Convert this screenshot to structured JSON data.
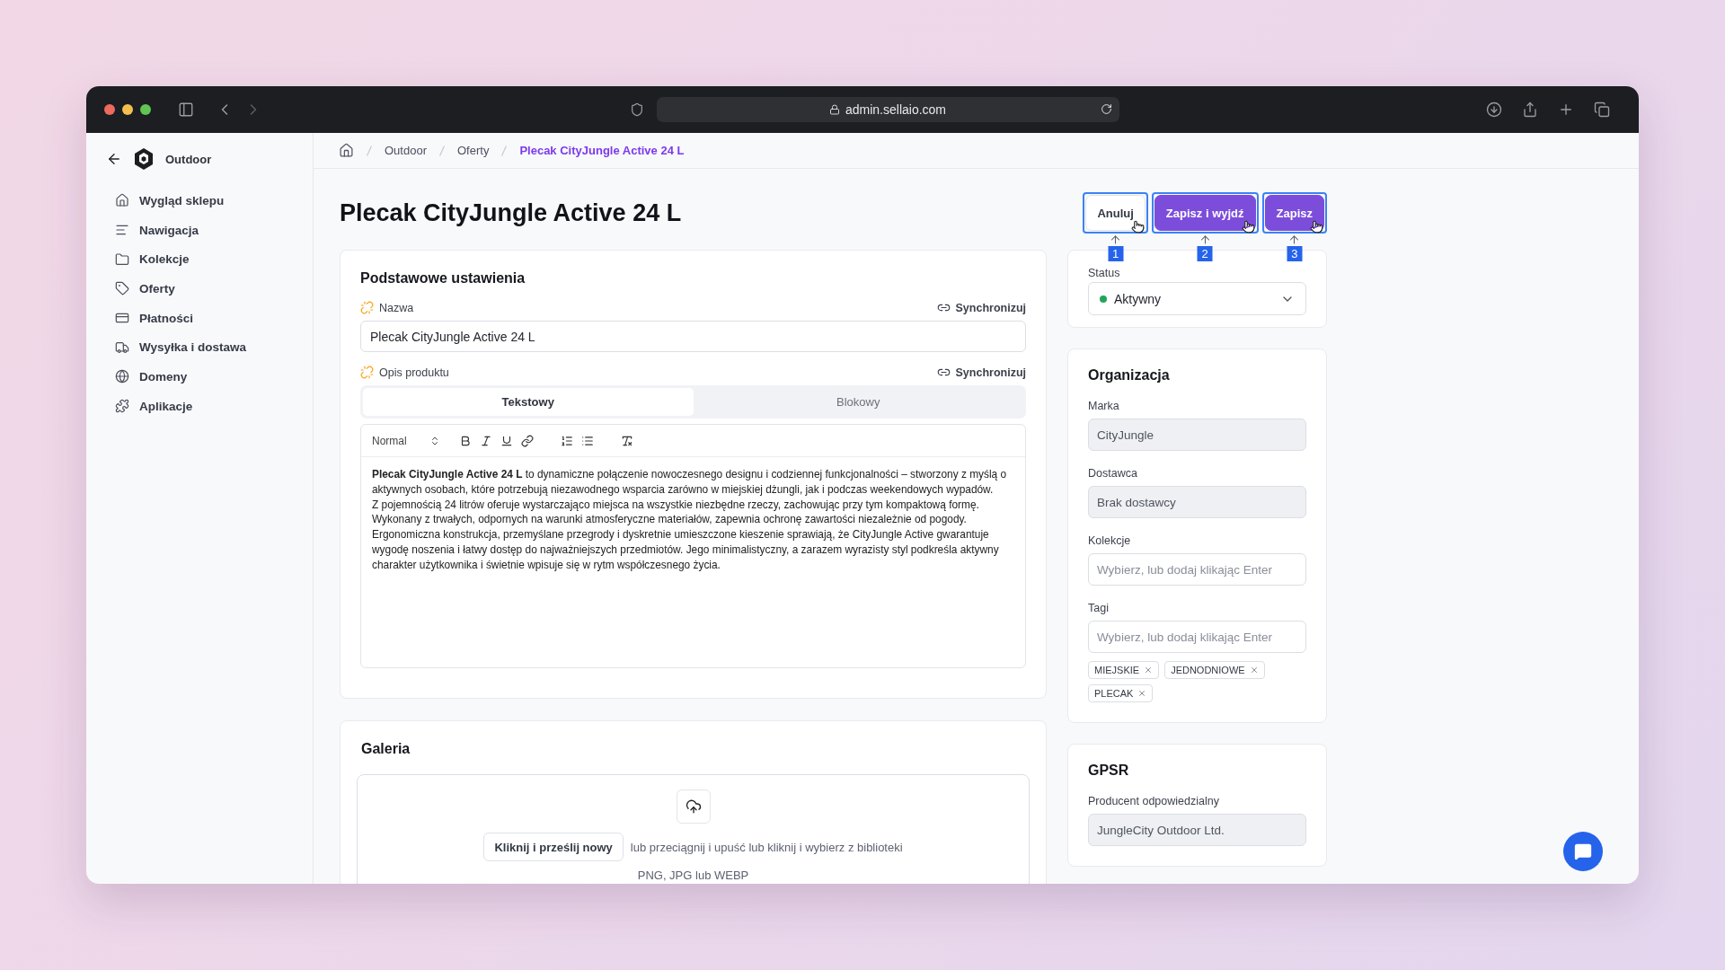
{
  "browser": {
    "url": "admin.sellaio.com"
  },
  "sidebar": {
    "store": "Outdoor",
    "items": [
      {
        "label": "Wygląd sklepu"
      },
      {
        "label": "Nawigacja"
      },
      {
        "label": "Kolekcje"
      },
      {
        "label": "Oferty"
      },
      {
        "label": "Płatności"
      },
      {
        "label": "Wysyłka i dostawa"
      },
      {
        "label": "Domeny"
      },
      {
        "label": "Aplikacje"
      }
    ]
  },
  "breadcrumb": [
    {
      "label": "Outdoor",
      "current": false
    },
    {
      "label": "Oferty",
      "current": false
    },
    {
      "label": "Plecak CityJungle Active 24 L",
      "current": true
    }
  ],
  "page_title": "Plecak CityJungle Active 24 L",
  "header_buttons": [
    {
      "label": "Anuluj",
      "kind": "secondary",
      "marker": "1"
    },
    {
      "label": "Zapisz i wyjdź",
      "kind": "primary",
      "marker": "2"
    },
    {
      "label": "Zapisz",
      "kind": "primary",
      "marker": "3"
    }
  ],
  "basic_settings": {
    "title": "Podstawowe ustawienia",
    "name": {
      "label": "Nazwa",
      "sync": "Synchronizuj",
      "value": "Plecak CityJungle Active 24 L"
    },
    "description": {
      "label": "Opis produktu",
      "sync": "Synchronizuj",
      "tabs": [
        {
          "label": "Tekstowy",
          "selected": true
        },
        {
          "label": "Blokowy",
          "selected": false
        }
      ],
      "format": "Normal",
      "paragraphs": [
        "**Plecak CityJungle Active 24 L** to dynamiczne połączenie nowoczesnego designu i codziennej funkcjonalności – stworzony z myślą o aktywnych osobach, które potrzebują niezawodnego wsparcia zarówno w miejskiej dżungli, jak i podczas weekendowych wypadów.",
        "Z pojemnością 24 litrów oferuje wystarczająco miejsca na wszystkie niezbędne rzeczy, zachowując przy tym kompaktową formę.",
        "Wykonany z trwałych, odpornych na warunki atmosferyczne materiałów, zapewnia ochronę zawartości niezależnie od pogody.",
        "Ergonomiczna konstrukcja, przemyślane przegrody i dyskretnie umieszczone kieszenie sprawiają, że CityJungle Active gwarantuje wygodę noszenia i łatwy dostęp do najważniejszych przedmiotów. Jego minimalistyczny, a zarazem wyrazisty styl podkreśla aktywny charakter użytkownika i świetnie wpisuje się w rytm współczesnego życia."
      ]
    }
  },
  "gallery": {
    "title": "Galeria",
    "upload_button": "Kliknij i prześlij nowy",
    "hint": "lub przeciągnij i upuść lub kliknij i wybierz z biblioteki",
    "formats": "PNG, JPG lub WEBP"
  },
  "status": {
    "label": "Status",
    "value": "Aktywny"
  },
  "organization": {
    "title": "Organizacja",
    "fields": [
      {
        "label": "Marka",
        "value": "CityJungle",
        "disabled": true
      },
      {
        "label": "Dostawca",
        "value": "Brak dostawcy",
        "disabled": true
      },
      {
        "label": "Kolekcje",
        "placeholder": "Wybierz, lub dodaj klikając Enter",
        "disabled": false
      },
      {
        "label": "Tagi",
        "placeholder": "Wybierz, lub dodaj klikając Enter",
        "disabled": false,
        "tags": [
          "MIEJSKIE",
          "JEDNODNIOWE",
          "PLECAK"
        ]
      }
    ]
  },
  "gpsr": {
    "title": "GPSR",
    "fields": [
      {
        "label": "Producent odpowiedzialny",
        "value": "JungleCity Outdoor Ltd.",
        "disabled": true
      }
    ]
  }
}
